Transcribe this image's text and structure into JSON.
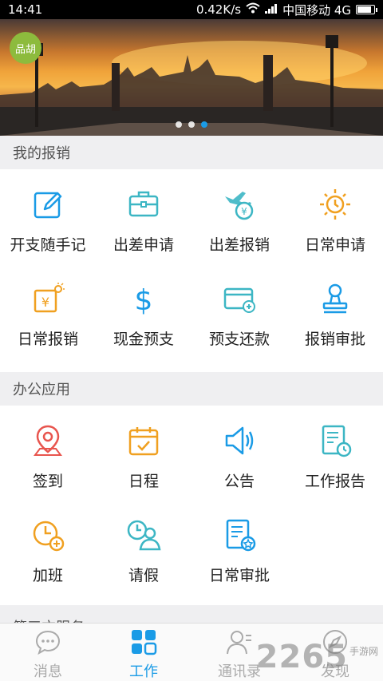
{
  "status_bar": {
    "time": "14:41",
    "speed": "0.42K/s",
    "carrier": "中国移动 4G"
  },
  "banner": {
    "badge": "品胡",
    "dots": 3,
    "active_dot": 3
  },
  "sections": {
    "expense": {
      "title": "我的报销",
      "items": [
        {
          "label": "开支随手记",
          "icon": "edit-icon"
        },
        {
          "label": "出差申请",
          "icon": "briefcase-icon"
        },
        {
          "label": "出差报销",
          "icon": "flight-money-icon"
        },
        {
          "label": "日常申请",
          "icon": "sun-clock-icon"
        },
        {
          "label": "日常报销",
          "icon": "yuan-receipt-icon"
        },
        {
          "label": "现金预支",
          "icon": "dollar-icon"
        },
        {
          "label": "预支还款",
          "icon": "card-icon"
        },
        {
          "label": "报销审批",
          "icon": "stamp-icon"
        }
      ]
    },
    "office": {
      "title": "办公应用",
      "items": [
        {
          "label": "签到",
          "icon": "location-pin-icon"
        },
        {
          "label": "日程",
          "icon": "calendar-icon"
        },
        {
          "label": "公告",
          "icon": "speaker-icon"
        },
        {
          "label": "工作报告",
          "icon": "report-icon"
        },
        {
          "label": "加班",
          "icon": "overtime-clock-icon"
        },
        {
          "label": "请假",
          "icon": "leave-person-icon"
        },
        {
          "label": "日常审批",
          "icon": "approval-doc-icon"
        }
      ]
    },
    "third_party_partial": "第三方服务"
  },
  "tabs": [
    {
      "label": "消息",
      "icon": "chat-bubble-icon",
      "active": false
    },
    {
      "label": "工作",
      "icon": "grid-apps-icon",
      "active": true
    },
    {
      "label": "通讯录",
      "icon": "contacts-icon",
      "active": false
    },
    {
      "label": "发现",
      "icon": "compass-icon",
      "active": false
    }
  ],
  "watermark": {
    "number": "2265",
    "text": "手游网"
  },
  "colors": {
    "accent": "#1a9be6",
    "orange": "#f0a020",
    "red": "#e8554e",
    "teal": "#3cb6c4"
  }
}
